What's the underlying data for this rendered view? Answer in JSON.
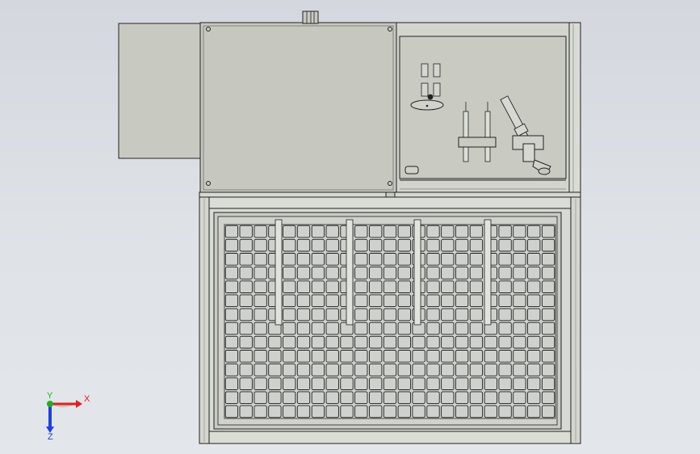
{
  "viewport": {
    "view": "front",
    "background_top": "#d4d8de",
    "background_bottom": "#e3e6ea",
    "line_color": "#1a1a1a",
    "panel_color": "#c9cbc2",
    "frame_color": "#d8dad4"
  },
  "model": {
    "parts": [
      "electrical-cabinet",
      "cabinet-side-box",
      "cabinet-door",
      "top-connector",
      "hinges",
      "upper-tool-panel",
      "pneumatic-fittings",
      "oval-badge",
      "vertical-guide-rods",
      "rod-clamp-block",
      "suction-cup-actuator",
      "status-indicator",
      "lower-frame",
      "grid-tray",
      "hanging-rods"
    ],
    "grid": {
      "columns": 23,
      "rows": 14
    }
  },
  "triad": {
    "x_label": "X",
    "y_label": "Y",
    "z_label": "Z",
    "x_color": "#e02020",
    "y_color": "#20b020",
    "z_color": "#2040e0"
  }
}
